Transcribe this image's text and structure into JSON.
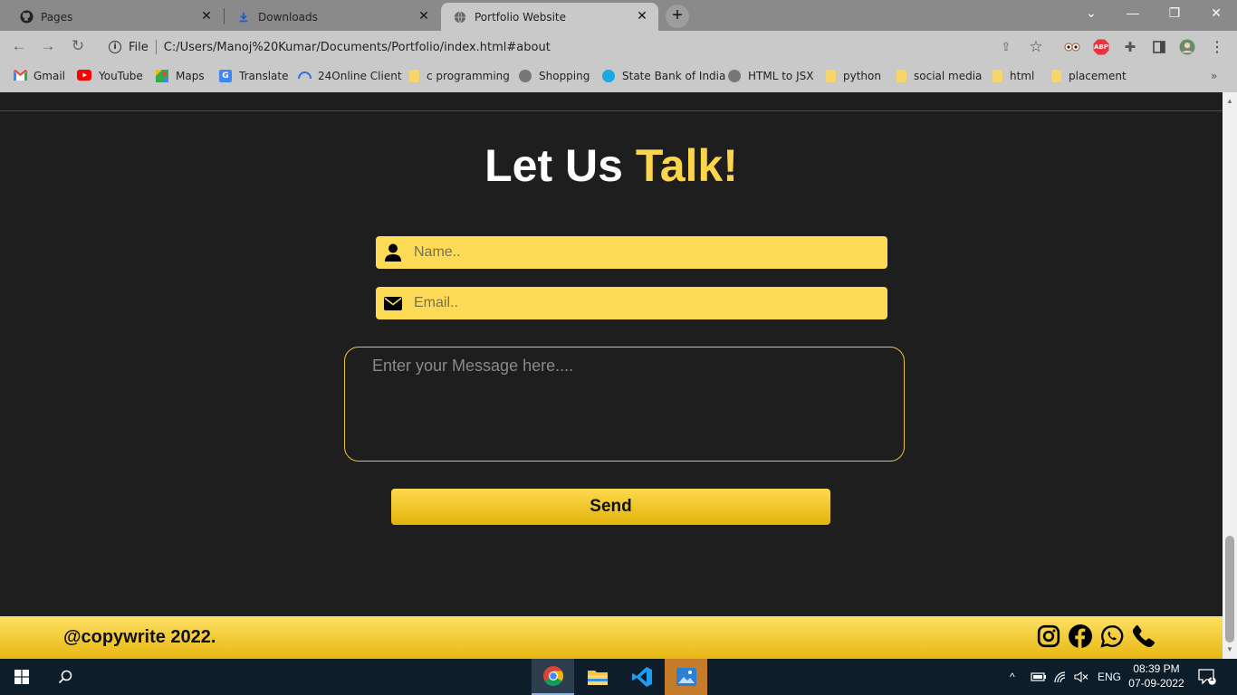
{
  "browser": {
    "tabs": [
      {
        "label": "Pages",
        "icon": "github-icon",
        "active": false
      },
      {
        "label": "Downloads",
        "icon": "downloads-icon",
        "active": false
      },
      {
        "label": "Portfolio Website",
        "icon": "globe-icon",
        "active": true
      }
    ],
    "address": {
      "scheme_label": "File",
      "url": "C:/Users/Manoj%20Kumar/Documents/Portfolio/index.html#about"
    },
    "bookmarks": [
      {
        "label": "Gmail",
        "icon": "gmail-icon"
      },
      {
        "label": "YouTube",
        "icon": "youtube-icon"
      },
      {
        "label": "Maps",
        "icon": "maps-icon"
      },
      {
        "label": "Translate",
        "icon": "translate-icon"
      },
      {
        "label": "24Online Client",
        "icon": "globe-icon"
      },
      {
        "label": "c programming",
        "icon": "folder-icon"
      },
      {
        "label": "Shopping",
        "icon": "globe-icon"
      },
      {
        "label": "State Bank of India",
        "icon": "sbi-icon"
      },
      {
        "label": "HTML to JSX",
        "icon": "globe-icon"
      },
      {
        "label": "python",
        "icon": "folder-icon"
      },
      {
        "label": "social media",
        "icon": "folder-icon"
      },
      {
        "label": "html",
        "icon": "folder-icon"
      },
      {
        "label": "placement",
        "icon": "folder-icon"
      }
    ],
    "more_bookmarks": "»",
    "extension_abp": "ABP"
  },
  "page": {
    "heading_part1": "Let Us",
    "heading_part2": "Talk!",
    "name_placeholder": "Name..",
    "email_placeholder": "Email..",
    "message_placeholder": "Enter your Message here....",
    "send_label": "Send",
    "footer_text": "@copywrite 2022.",
    "accent_color": "#fdd54a",
    "background_color": "#1e1e1e"
  },
  "taskbar": {
    "apps": [
      "chrome-icon",
      "file-explorer-icon",
      "vscode-icon",
      "photos-icon"
    ],
    "language": "ENG",
    "time": "08:39 PM",
    "date": "07-09-2022",
    "notification_count": "1"
  }
}
